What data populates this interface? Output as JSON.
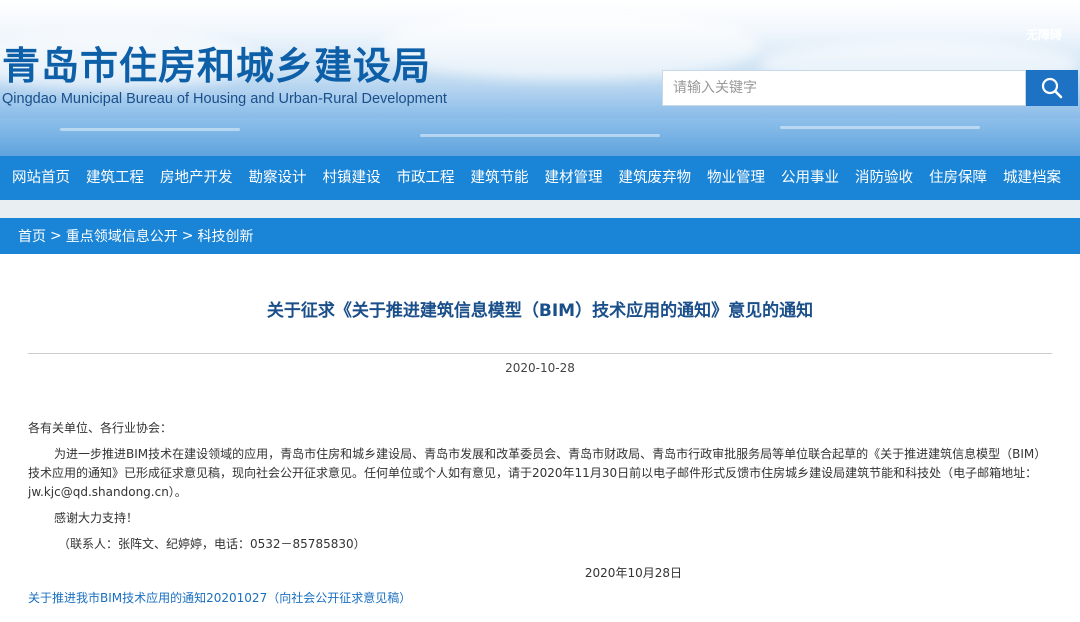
{
  "header": {
    "site_name_cn": "青岛市住房和城乡建设局",
    "site_name_en": "Qingdao Municipal Bureau of Housing and Urban-Rural Development",
    "accessibility_label": "无障碍",
    "search": {
      "placeholder": "请输入关键字",
      "icon": "search-icon"
    }
  },
  "nav": {
    "items": [
      {
        "label": "网站首页"
      },
      {
        "label": "建筑工程"
      },
      {
        "label": "房地产开发"
      },
      {
        "label": "勘察设计"
      },
      {
        "label": "村镇建设"
      },
      {
        "label": "市政工程"
      },
      {
        "label": "建筑节能"
      },
      {
        "label": "建材管理"
      },
      {
        "label": "建筑废弃物"
      },
      {
        "label": "物业管理"
      },
      {
        "label": "公用事业"
      },
      {
        "label": "消防验收"
      },
      {
        "label": "住房保障"
      },
      {
        "label": "城建档案"
      }
    ]
  },
  "breadcrumb": {
    "items": [
      "首页",
      "重点领域信息公开",
      "科技创新"
    ],
    "separator": ">"
  },
  "article": {
    "title": "关于征求《关于推进建筑信息模型（BIM）技术应用的通知》意见的通知",
    "date": "2020-10-28",
    "greeting": "各有关单位、各行业协会：",
    "main_paragraph": "为进一步推进BIM技术在建设领域的应用，青岛市住房和城乡建设局、青岛市发展和改革委员会、青岛市财政局、青岛市行政审批服务局等单位联合起草的《关于推进建筑信息模型（BIM）技术应用的通知》已形成征求意见稿，现向社会公开征求意见。任何单位或个人如有意见，请于2020年11月30日前以电子邮件形式反馈市住房城乡建设局建筑节能和科技处（电子邮箱地址：jw.kjc@qd.shandong.cn）。",
    "thanks": "感谢大力支持！",
    "contact": "（联系人：张阵文、纪婷婷，电话：0532－85785830）",
    "sign_date": "2020年10月28日",
    "attachment": "关于推进我市BIM技术应用的通知20201027（向社会公开征求意见稿）"
  },
  "colors": {
    "brand_blue": "#1a84d6",
    "title_blue": "#1a4f8a",
    "link_blue": "#1a6fc0",
    "search_button": "#1e72c4"
  }
}
